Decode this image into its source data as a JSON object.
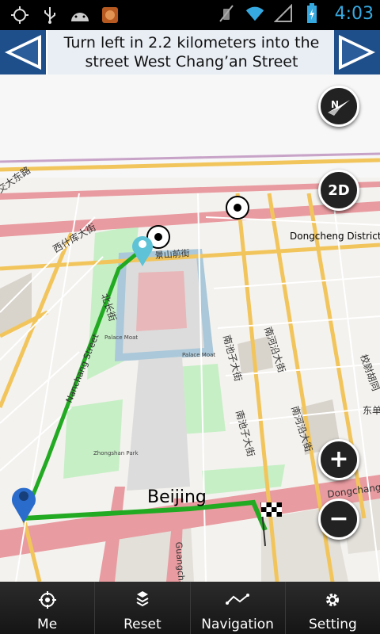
{
  "status_bar": {
    "time": "4:03",
    "icons": [
      "gps-icon",
      "usb-icon",
      "android-icon",
      "app-icon",
      "mute-icon",
      "wifi-icon",
      "signal-icon",
      "battery-icon"
    ],
    "time_color": "#36a9e0"
  },
  "instruction": {
    "text": "Turn left in 2.2 kilometers into the street West Chang’an Street",
    "prev_icon": "arrow-left-icon",
    "next_icon": "arrow-right-icon"
  },
  "map": {
    "labels": {
      "city": "Beijing",
      "district": "Dongcheng District",
      "changan": "Dongchang'an",
      "nanchang": "Nanchang Street",
      "xishiku": "西什库大街",
      "beichang": "北长街",
      "nanheyan": "南河沿大街",
      "nanchizi": "南池子大街",
      "jiaodong": "交大东路",
      "xiaoyan": "校尉胡同",
      "dongdan": "东单",
      "jingshan": "景山前街",
      "palace_moat_w": "Palace Moat",
      "palace_moat_e": "Palace Moat",
      "zhongshan": "Zhongshan Park",
      "guangchang": "Guangcha"
    },
    "colors": {
      "route": "#22aa22",
      "major_road": "#e89ba0",
      "secondary_road": "#f7d37c",
      "park": "#c6efc6"
    }
  },
  "controls": {
    "compass_label": "N",
    "view_mode_label": "2D",
    "zoom_in_label": "+",
    "zoom_out_label": "−"
  },
  "bottom_nav": [
    {
      "label": "Me",
      "icon": "crosshair-icon"
    },
    {
      "label": "Reset",
      "icon": "reset-icon"
    },
    {
      "label": "Navigation",
      "icon": "route-icon"
    },
    {
      "label": "Setting",
      "icon": "gear-icon"
    }
  ]
}
